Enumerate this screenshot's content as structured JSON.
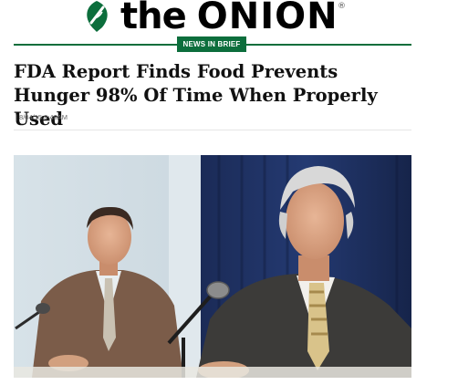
{
  "masthead": {
    "logo_the": "the",
    "logo_onion": "ONION",
    "registered_mark": "®",
    "icon": "onion-leaf-icon",
    "brand_color": "#0c6e3c"
  },
  "section": {
    "badge": "NEWS IN BRIEF"
  },
  "article": {
    "headline": "FDA Report Finds Food Prevents Hunger 98% Of Time When Properly Used",
    "dateline": "| 8/04/15 8:48AM",
    "image": "photo-two-men-press-conference"
  }
}
